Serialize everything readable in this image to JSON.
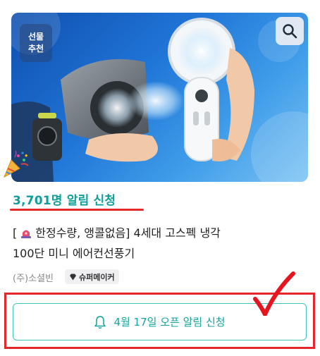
{
  "product": {
    "badge_line1": "선물",
    "badge_line2": "추천",
    "alert_count": "3,701명 알림 신청",
    "title_prefix": "[",
    "title_line1": "한정수량, 앵콜없음] 4세대 고스펙 냉각",
    "title_line2": "100단 미니 에어컨선풍기",
    "seller": "(주)소셜빈",
    "maker_badge": "슈퍼메이커"
  },
  "notify_button": {
    "label": "4월 17일 오픈 알림 신청"
  },
  "icons": {
    "search": "search-icon",
    "bell": "bell-icon",
    "party": "party-popper-icon",
    "siren": "siren-icon",
    "diamond": "diamond-icon"
  },
  "colors": {
    "accent": "#14a49d",
    "highlight_red": "#e5262a"
  }
}
